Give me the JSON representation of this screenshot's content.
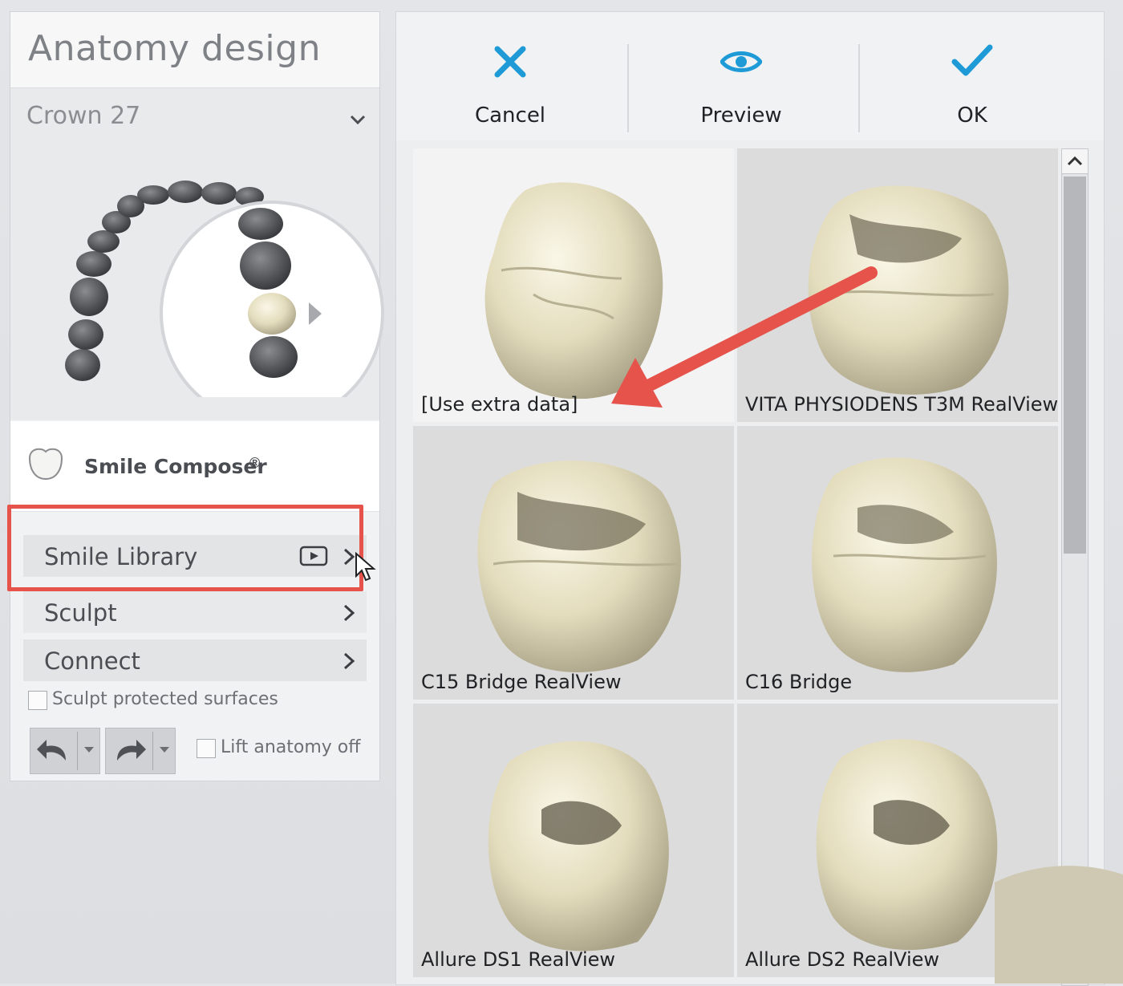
{
  "header": {
    "title": "Anatomy design"
  },
  "crown_select": {
    "value": "Crown 27"
  },
  "composer": {
    "label": "Smile Composer",
    "mark": "®"
  },
  "menu": {
    "library": "Smile Library",
    "sculpt": "Sculpt",
    "connect": "Connect"
  },
  "options": {
    "sculpt_protected": "Sculpt protected surfaces",
    "lift_anatomy": "Lift anatomy off"
  },
  "toolbar": {
    "cancel": "Cancel",
    "preview": "Preview",
    "ok": "OK"
  },
  "library": {
    "items": [
      {
        "label": "[Use extra data]"
      },
      {
        "label": "VITA PHYSIODENS T3M RealView"
      },
      {
        "label": "C15 Bridge RealView"
      },
      {
        "label": "C16 Bridge"
      },
      {
        "label": "Allure DS1 RealView"
      },
      {
        "label": "Allure DS2 RealView"
      }
    ]
  },
  "colors": {
    "accent": "#1e9bd7",
    "highlight": "#e5534b",
    "tooth": "#e6e0c2"
  },
  "icons": {
    "cancel": "close-icon",
    "preview": "eye-icon",
    "ok": "checkmark-icon",
    "video": "video-icon",
    "undo": "undo-icon",
    "redo": "redo-icon"
  }
}
